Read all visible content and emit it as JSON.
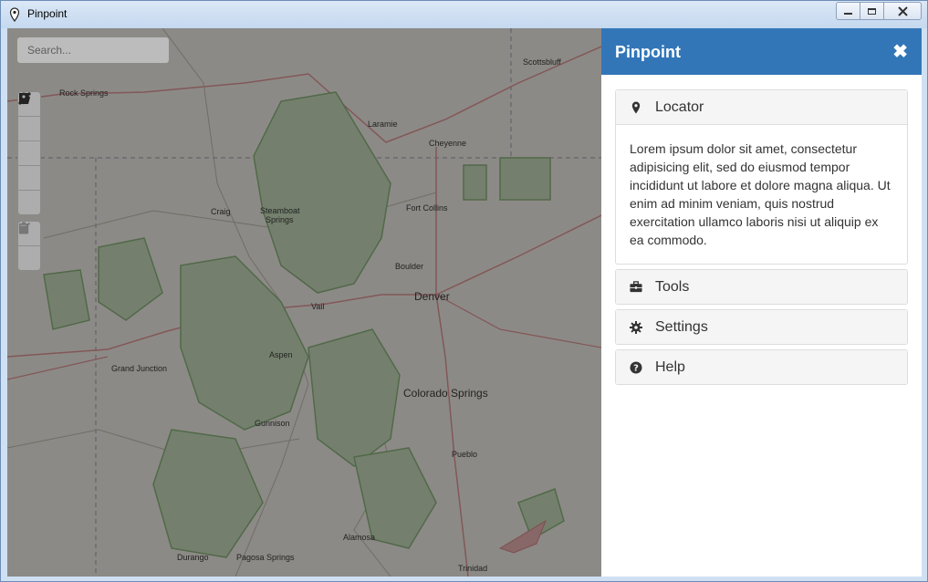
{
  "window": {
    "title": "Pinpoint"
  },
  "map": {
    "search_placeholder": "Search...",
    "draw_tools": [
      "polyline-icon",
      "polygon-icon",
      "rectangle-icon",
      "circle-icon",
      "marker-icon"
    ],
    "edit_tools": [
      "edit-icon",
      "trash-icon"
    ],
    "labels": {
      "rock_springs": "Rock Springs",
      "scottsbluff": "Scottsbluff",
      "laramie": "Laramie",
      "cheyenne": "Cheyenne",
      "craig": "Craig",
      "steamboat": "Steamboat",
      "springs": "Springs",
      "fort_collins": "Fort Collins",
      "boulder": "Boulder",
      "denver": "Denver",
      "vail": "Vail",
      "aspen": "Aspen",
      "grand_junction": "Grand Junction",
      "colorado_springs": "Colorado Springs",
      "gunnison": "Gunnison",
      "pueblo": "Pueblo",
      "alamosa": "Alamosa",
      "durango": "Durango",
      "pagosa_springs": "Pagosa Springs",
      "trinidad": "Trinidad"
    }
  },
  "sidebar": {
    "title": "Pinpoint",
    "close_glyph": "✖",
    "panels": [
      {
        "label": "Locator",
        "icon": "map-marker-icon",
        "body": "Lorem ipsum dolor sit amet, consectetur adipisicing elit, sed do eiusmod tempor incididunt ut labore et dolore magna aliqua. Ut enim ad minim veniam, quis nostrud exercitation ullamco laboris nisi ut aliquip ex ea commodo."
      },
      {
        "label": "Tools",
        "icon": "briefcase-icon"
      },
      {
        "label": "Settings",
        "icon": "gear-icon"
      },
      {
        "label": "Help",
        "icon": "question-circle-icon"
      }
    ]
  },
  "colors": {
    "header_blue": "#3276b8"
  }
}
